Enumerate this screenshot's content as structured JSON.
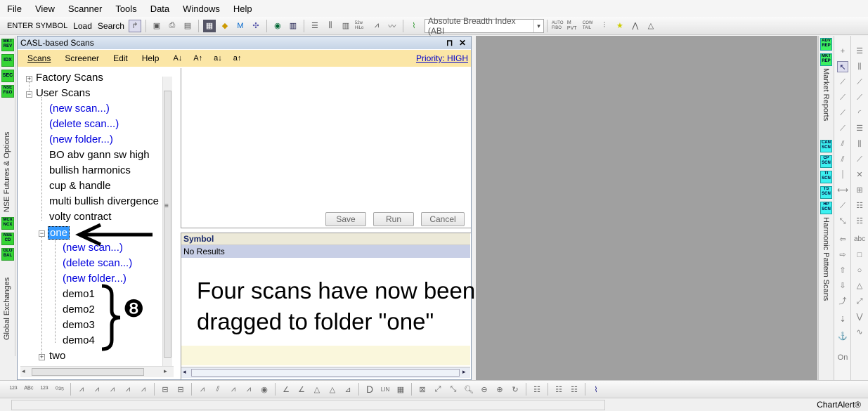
{
  "menu": [
    "File",
    "View",
    "Scanner",
    "Tools",
    "Data",
    "Windows",
    "Help"
  ],
  "toolbar": {
    "enter_symbol": "ENTER SYMBOL",
    "load": "Load",
    "search": "Search",
    "indicator_combo": "Absolute Breadth Index (ABI",
    "icon_labels": [
      "52w HiLo",
      "AUTO FIBO",
      "M PVT",
      "COW TAIL"
    ]
  },
  "left_strip": {
    "buttons": [
      "MKT REV",
      "IDX",
      "SEC",
      "NSE F&O",
      "MCX NCX",
      "NSE CD",
      "GLO BAL"
    ],
    "label_top": "NSE Futures & Options",
    "label_bottom": "Global Exchanges"
  },
  "panel": {
    "title": "CASL-based Scans",
    "pin": "⊓",
    "close": "✕",
    "menu": [
      "Scans",
      "Screener",
      "Edit",
      "Help"
    ],
    "sort_icons": [
      "A↓",
      "A↑",
      "a↓",
      "a↑"
    ],
    "priority": "Priority: HIGH"
  },
  "tree": {
    "factory": "Factory Scans",
    "user": "User Scans",
    "new_scan": "(new scan...)",
    "delete_scan": "(delete scan...)",
    "new_folder": "(new folder...)",
    "items": [
      "BO abv gann sw high",
      "bullish harmonics",
      "cup & handle",
      "multi bullish divergence",
      "volty contract"
    ],
    "folder_one": "one",
    "sub_new_scan": "(new scan...)",
    "sub_delete_scan": "(delete scan...)",
    "sub_new_folder": "(new folder...)",
    "demos": [
      "demo1",
      "demo2",
      "demo3",
      "demo4"
    ],
    "folder_two": "two",
    "marker": "❽"
  },
  "editor": {
    "save": "Save",
    "run": "Run",
    "cancel": "Cancel"
  },
  "results": {
    "header": "Symbol",
    "row": "No Results"
  },
  "annotation": "Four scans have now been dragged to folder \"one\"",
  "right_strip": {
    "buttons_top": [
      "ADV REP",
      "MKT REP"
    ],
    "label_top": "Market Reports",
    "buttons_bottom": [
      "CAN SCN",
      "CP SCN",
      "TI SCN",
      "TS SCN",
      "HP SCN"
    ],
    "label_bottom": "Harmonic Pattern Scans",
    "on_label": "On",
    "abc_label": "abc"
  },
  "status": {
    "brand": "ChartAlert®"
  }
}
